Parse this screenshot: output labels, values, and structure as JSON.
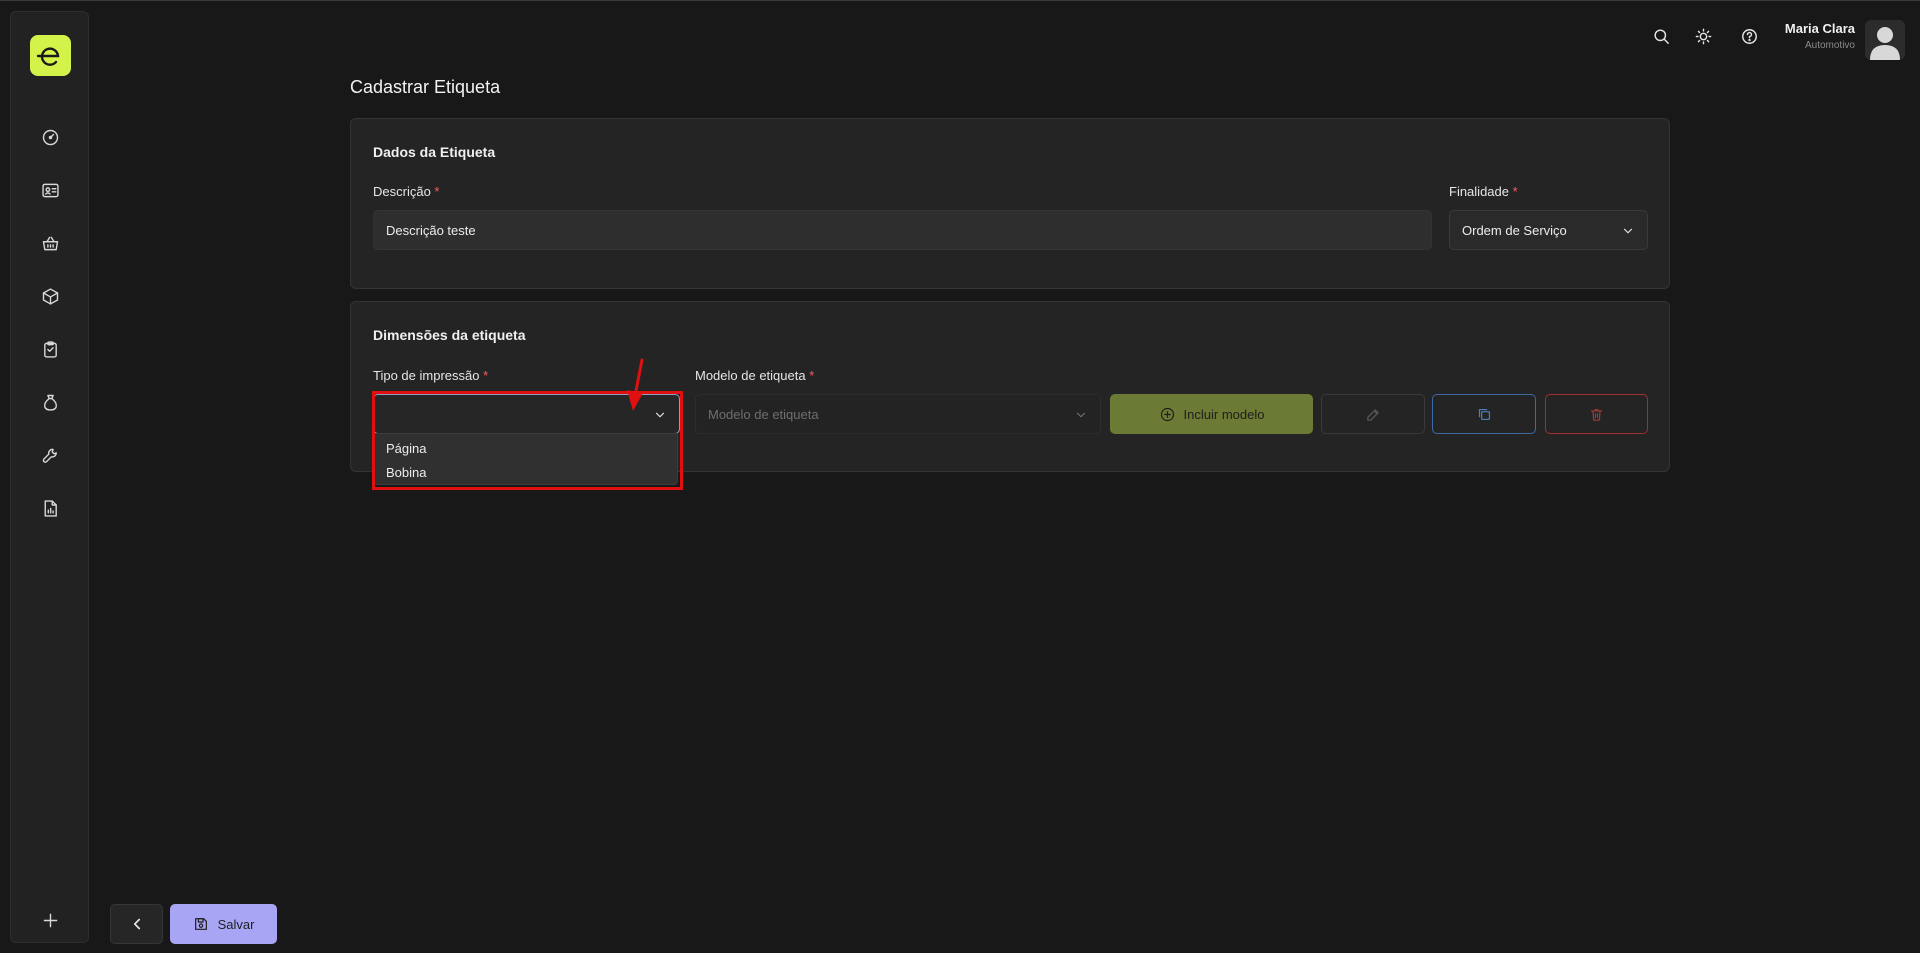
{
  "header": {
    "user_name": "Maria Clara",
    "user_role": "Automotivo"
  },
  "page": {
    "title": "Cadastrar Etiqueta"
  },
  "label_data": {
    "section_title": "Dados da Etiqueta",
    "description_label": "Descrição",
    "description_value": "Descrição teste",
    "purpose_label": "Finalidade",
    "purpose_value": "Ordem de Serviço",
    "required_mark": "*"
  },
  "dimensions": {
    "section_title": "Dimensões da etiqueta",
    "print_type_label": "Tipo de impressão",
    "print_type_value": "",
    "print_type_options": [
      "Página",
      "Bobina"
    ],
    "model_label": "Modelo de etiqueta",
    "model_placeholder": "Modelo de etiqueta",
    "include_model_label": "Incluir modelo"
  },
  "footer": {
    "save_label": "Salvar"
  },
  "colors": {
    "brand_accent": "#d4f34a",
    "include_button": "#6b7a34",
    "save_button": "#a9a5f5",
    "copy_button_border": "#3d6aa0",
    "delete_button_border": "#a03030",
    "annotation_red": "#e01010"
  }
}
